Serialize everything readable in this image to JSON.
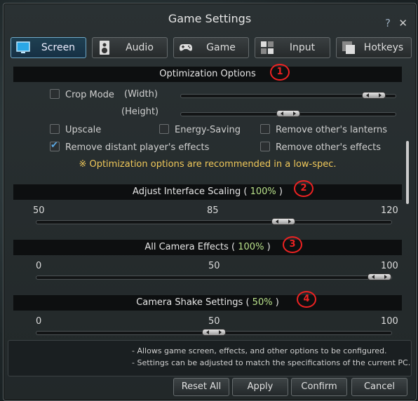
{
  "window": {
    "title": "Game Settings",
    "help": "?",
    "close": "✕"
  },
  "tabs": [
    {
      "label": "Screen",
      "icon": "monitor-icon",
      "active": true
    },
    {
      "label": "Audio",
      "icon": "speaker-icon",
      "active": false
    },
    {
      "label": "Game",
      "icon": "gamepad-icon",
      "active": false
    },
    {
      "label": "Input",
      "icon": "keyboard-icon",
      "active": false
    },
    {
      "label": "Hotkeys",
      "icon": "window-icon",
      "active": false
    }
  ],
  "optimization": {
    "title": "Optimization Options",
    "crop_mode": {
      "label": "Crop Mode",
      "checked": false,
      "width_label": "(Width)",
      "height_label": "(Height)",
      "width_value": 0.95,
      "height_value": 0.5
    },
    "upscale": {
      "label": "Upscale",
      "checked": false
    },
    "energy_saving": {
      "label": "Energy-Saving",
      "checked": false
    },
    "remove_lanterns": {
      "label": "Remove other's lanterns",
      "checked": false
    },
    "remove_distant": {
      "label": "Remove distant player's effects",
      "checked": true
    },
    "remove_others": {
      "label": "Remove other's effects",
      "checked": false
    },
    "note": "※ Optimization options are recommended in a low-spec."
  },
  "interface_scaling": {
    "title": "Adjust Interface Scaling",
    "value_text": "100%",
    "min": "50",
    "mid": "85",
    "max": "120",
    "value_fraction": 0.71
  },
  "camera_effects": {
    "title": "All Camera Effects",
    "value_text": "100%",
    "min": "0",
    "mid": "50",
    "max": "100",
    "value_fraction": 1.0
  },
  "camera_shake": {
    "title": "Camera Shake Settings",
    "value_text": "50%",
    "min": "0",
    "mid": "50",
    "max": "100",
    "value_fraction": 0.5
  },
  "annotations": [
    "1",
    "2",
    "3",
    "4"
  ],
  "info": [
    "- Allows game screen, effects, and other options to be configured.",
    "- Settings can be adjusted to match the specifications of the current PC."
  ],
  "buttons": {
    "reset": "Reset All",
    "apply": "Apply",
    "confirm": "Confirm",
    "cancel": "Cancel"
  }
}
